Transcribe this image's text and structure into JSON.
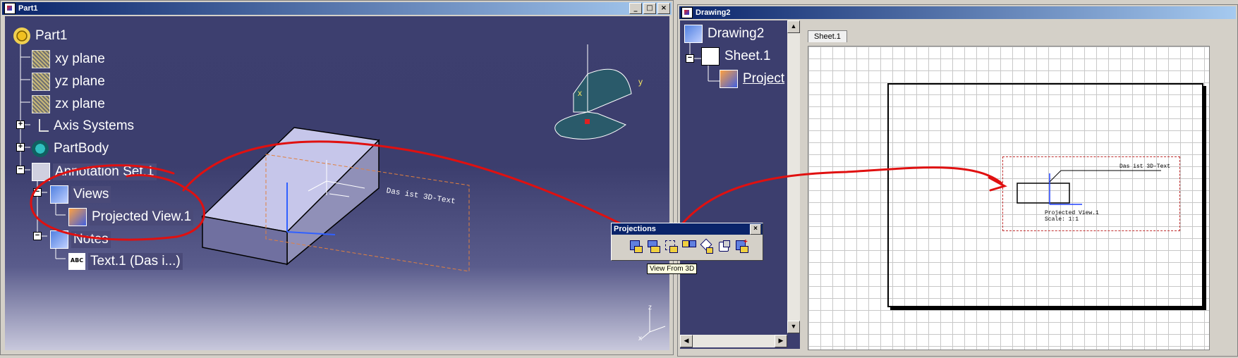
{
  "part_window": {
    "title": "Part1",
    "buttons": [
      "_",
      "□",
      "×"
    ],
    "tree": {
      "root": "Part1",
      "items": [
        {
          "label": "xy plane"
        },
        {
          "label": "yz plane"
        },
        {
          "label": "zx plane"
        },
        {
          "label": "Axis Systems"
        },
        {
          "label": "PartBody"
        },
        {
          "label": "Annotation Set.1"
        },
        {
          "label": "Views"
        },
        {
          "label": "Projected View.1"
        },
        {
          "label": "Notes"
        },
        {
          "label": "Text.1 (Das i...)"
        }
      ]
    },
    "model_text": "Das ist 3D-Text",
    "compass": {
      "y": "y",
      "x": "x"
    },
    "axis_labels": {
      "z": "z",
      "x": "x"
    }
  },
  "projections_toolbar": {
    "title": "Projections",
    "close": "×",
    "tooltip": "View From 3D",
    "icons": [
      "front-view-icon",
      "unfolded-view-icon",
      "view-from-3d-icon",
      "projection-view-icon",
      "auxiliary-view-icon",
      "isometric-view-icon",
      "advanced-front-view-icon"
    ]
  },
  "drawing_window": {
    "title": "Drawing2",
    "tree": {
      "root": "Drawing2",
      "sheet": "Sheet.1",
      "view": "Project"
    },
    "sheet_tab": "Sheet.1",
    "view_text": "Das ist 3D-Text",
    "view_caption": "Projected View.1",
    "scale_label": "Scale:  1:1"
  },
  "colors": {
    "annotation": "#e01010",
    "title_active": "#0a246a",
    "viewport": "#3d3f6f"
  }
}
